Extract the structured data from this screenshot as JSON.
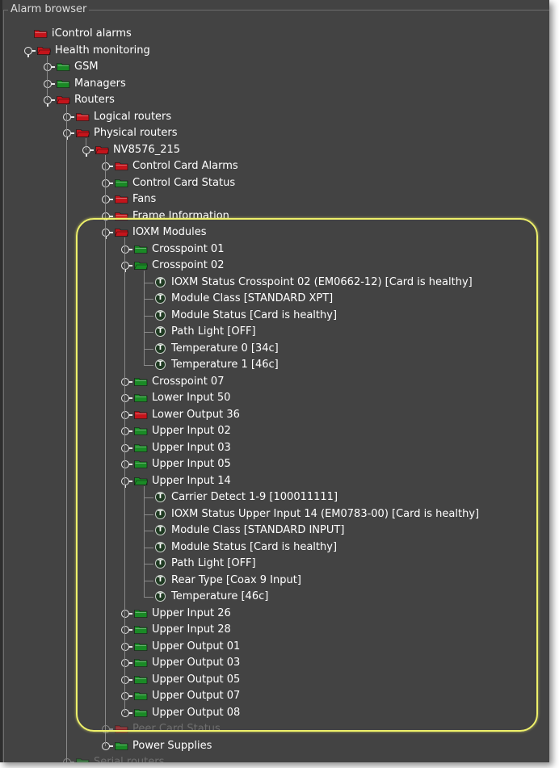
{
  "panel": {
    "title": "Alarm browser"
  },
  "colors": {
    "red_folder": "#c4141b",
    "green_folder": "#1a8a26",
    "highlight": "#eef06a",
    "background": "#434343"
  },
  "tree": [
    {
      "label": "iControl alarms",
      "icon": "red-folder",
      "level": 0,
      "handle": "none"
    },
    {
      "label": "Health monitoring",
      "icon": "red-folder-open",
      "level": 1,
      "handle": "open"
    },
    {
      "label": "GSM",
      "icon": "green-folder",
      "level": 2,
      "handle": "closed"
    },
    {
      "label": "Managers",
      "icon": "green-folder",
      "level": 2,
      "handle": "closed"
    },
    {
      "label": "Routers",
      "icon": "red-folder-open",
      "level": 2,
      "handle": "open"
    },
    {
      "label": "Logical routers",
      "icon": "red-folder",
      "level": 3,
      "handle": "closed"
    },
    {
      "label": "Physical routers",
      "icon": "red-folder-open",
      "level": 3,
      "handle": "open"
    },
    {
      "label": "NV8576_215",
      "icon": "red-folder-open",
      "level": 4,
      "handle": "open"
    },
    {
      "label": "Control Card Alarms",
      "icon": "red-folder",
      "level": 5,
      "handle": "closed"
    },
    {
      "label": "Control Card Status",
      "icon": "green-folder",
      "level": 5,
      "handle": "closed"
    },
    {
      "label": "Fans",
      "icon": "red-folder",
      "level": 5,
      "handle": "closed"
    },
    {
      "label": "Frame Information",
      "icon": "red-folder",
      "level": 5,
      "handle": "closed"
    },
    {
      "label": "IOXM Modules",
      "icon": "red-folder-open",
      "level": 5,
      "handle": "open"
    },
    {
      "label": "Crosspoint 01",
      "icon": "green-folder",
      "level": 6,
      "handle": "closed"
    },
    {
      "label": "Crosspoint 02",
      "icon": "green-folder-open",
      "level": 6,
      "handle": "open"
    },
    {
      "label": "IOXM Status Crosspoint 02 (EM0662-12) [Card is healthy]",
      "icon": "t-leaf",
      "level": 7,
      "handle": "none"
    },
    {
      "label": "Module Class [STANDARD XPT]",
      "icon": "t-leaf",
      "level": 7,
      "handle": "none"
    },
    {
      "label": "Module Status [Card is healthy]",
      "icon": "t-leaf",
      "level": 7,
      "handle": "none"
    },
    {
      "label": "Path Light [OFF]",
      "icon": "t-leaf",
      "level": 7,
      "handle": "none"
    },
    {
      "label": "Temperature 0 [34c]",
      "icon": "t-leaf",
      "level": 7,
      "handle": "none"
    },
    {
      "label": "Temperature 1 [46c]",
      "icon": "t-leaf",
      "level": 7,
      "handle": "none"
    },
    {
      "label": "Crosspoint 07",
      "icon": "green-folder",
      "level": 6,
      "handle": "closed"
    },
    {
      "label": "Lower Input 50",
      "icon": "green-folder",
      "level": 6,
      "handle": "closed"
    },
    {
      "label": "Lower Output 36",
      "icon": "red-folder",
      "level": 6,
      "handle": "closed"
    },
    {
      "label": "Upper Input 02",
      "icon": "green-folder",
      "level": 6,
      "handle": "closed"
    },
    {
      "label": "Upper Input 03",
      "icon": "green-folder",
      "level": 6,
      "handle": "closed"
    },
    {
      "label": "Upper Input 05",
      "icon": "green-folder",
      "level": 6,
      "handle": "closed"
    },
    {
      "label": "Upper Input 14",
      "icon": "green-folder-open",
      "level": 6,
      "handle": "open"
    },
    {
      "label": "Carrier Detect 1-9 [100011111]",
      "icon": "t-leaf",
      "level": 7,
      "handle": "none"
    },
    {
      "label": "IOXM Status Upper Input 14 (EM0783-00) [Card is healthy]",
      "icon": "t-leaf",
      "level": 7,
      "handle": "none"
    },
    {
      "label": "Module Class [STANDARD INPUT]",
      "icon": "t-leaf",
      "level": 7,
      "handle": "none"
    },
    {
      "label": "Module Status [Card is healthy]",
      "icon": "t-leaf",
      "level": 7,
      "handle": "none"
    },
    {
      "label": "Path Light [OFF]",
      "icon": "t-leaf",
      "level": 7,
      "handle": "none"
    },
    {
      "label": "Rear Type [Coax 9 Input]",
      "icon": "t-leaf",
      "level": 7,
      "handle": "none"
    },
    {
      "label": "Temperature [46c]",
      "icon": "t-leaf",
      "level": 7,
      "handle": "none"
    },
    {
      "label": "Upper Input 26",
      "icon": "green-folder",
      "level": 6,
      "handle": "closed"
    },
    {
      "label": "Upper Input 28",
      "icon": "green-folder",
      "level": 6,
      "handle": "closed"
    },
    {
      "label": "Upper Output 01",
      "icon": "green-folder",
      "level": 6,
      "handle": "closed"
    },
    {
      "label": "Upper Output 03",
      "icon": "green-folder",
      "level": 6,
      "handle": "closed"
    },
    {
      "label": "Upper Output 05",
      "icon": "green-folder",
      "level": 6,
      "handle": "closed"
    },
    {
      "label": "Upper Output 07",
      "icon": "green-folder",
      "level": 6,
      "handle": "closed"
    },
    {
      "label": "Upper Output 08",
      "icon": "green-folder",
      "level": 6,
      "handle": "closed"
    },
    {
      "label": "Peer Card Status",
      "icon": "red-folder",
      "level": 5,
      "handle": "closed",
      "dim": true
    },
    {
      "label": "Power Supplies",
      "icon": "green-folder",
      "level": 5,
      "handle": "closed"
    },
    {
      "label": "Serial routers",
      "icon": "green-folder",
      "level": 3,
      "handle": "closed",
      "dim": true
    }
  ]
}
